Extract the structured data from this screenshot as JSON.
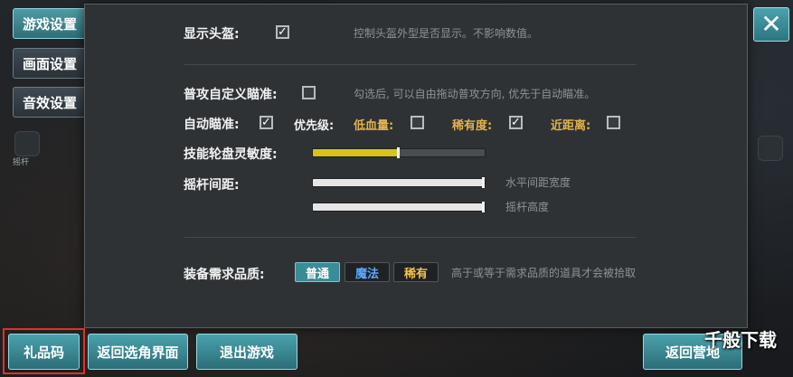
{
  "side_tabs": [
    {
      "label": "游戏设置"
    },
    {
      "label": "画面设置"
    },
    {
      "label": "音效设置"
    }
  ],
  "background_hud": {
    "small_label": "摇杆"
  },
  "panel": {
    "helmet": {
      "label": "显示头盔:",
      "checked": true,
      "hint": "控制头盔外型是否显示。不影响数值。"
    },
    "custom_aim": {
      "label": "普攻自定义瞄准:",
      "checked": false,
      "hint": "勾选后, 可以自由拖动普攻方向, 优先于自动瞄准。"
    },
    "auto_aim": {
      "label": "自动瞄准:",
      "checked": true,
      "priority_label": "优先级:",
      "options": [
        {
          "label": "低血量:",
          "checked": false,
          "color": "#e2b24a"
        },
        {
          "label": "稀有度:",
          "checked": true,
          "color": "#e2b24a"
        },
        {
          "label": "近距离:",
          "checked": false,
          "color": "#e2b24a"
        }
      ]
    },
    "skill_sensitivity": {
      "label": "技能轮盘灵敏度:",
      "value_fraction": 0.5
    },
    "joystick": {
      "label": "摇杆间距:",
      "horizontal": {
        "hint": "水平间距宽度",
        "value_fraction": 1.0
      },
      "height": {
        "hint": "摇杆高度",
        "value_fraction": 1.0
      }
    },
    "equip_quality": {
      "label": "装备需求品质:",
      "options": [
        {
          "label": "普通",
          "selected": true,
          "color": "#ffffff"
        },
        {
          "label": "魔法",
          "selected": false,
          "color": "#5aa8ff"
        },
        {
          "label": "稀有",
          "selected": false,
          "color": "#f2c24a"
        }
      ],
      "hint": "高于或等于需求品质的道具才会被拾取"
    }
  },
  "bottom": {
    "gift_code": "礼品码",
    "back_to_character": "返回选角界面",
    "exit_game": "退出游戏",
    "back_to_camp": "返回营地"
  },
  "close_icon": "close-icon",
  "watermark": "千般下载",
  "colors": {
    "accent": "#3a8c96",
    "slider_fill": "#d9c21a",
    "panel": "#2f3235"
  }
}
